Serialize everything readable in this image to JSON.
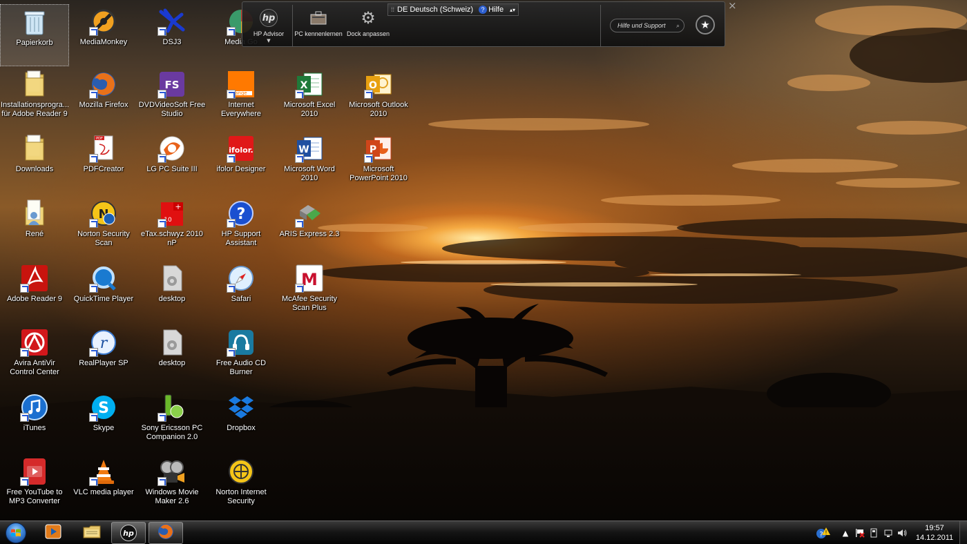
{
  "desktop": {
    "icons": [
      {
        "label": "Papierkorb",
        "icon": "recycle-bin-icon",
        "shortcut": false
      },
      {
        "label": "Installationsprogra... für Adobe Reader 9",
        "icon": "folder-icon",
        "shortcut": false
      },
      {
        "label": "Downloads",
        "icon": "folder-icon",
        "shortcut": false
      },
      {
        "label": "René",
        "icon": "user-folder-icon",
        "shortcut": false
      },
      {
        "label": "Adobe Reader 9",
        "icon": "adobe-reader-icon",
        "shortcut": true
      },
      {
        "label": "Avira AntiVir Control Center",
        "icon": "avira-icon",
        "shortcut": true
      },
      {
        "label": "iTunes",
        "icon": "itunes-icon",
        "shortcut": true
      },
      {
        "label": "Free YouTube to MP3 Converter",
        "icon": "youtube-mp3-icon",
        "shortcut": true
      },
      {
        "label": "MediaMonkey",
        "icon": "mediamonkey-icon",
        "shortcut": true
      },
      {
        "label": "Mozilla Firefox",
        "icon": "firefox-icon",
        "shortcut": true
      },
      {
        "label": "PDFCreator",
        "icon": "pdfcreator-icon",
        "shortcut": true
      },
      {
        "label": "Norton Security Scan",
        "icon": "norton-scan-icon",
        "shortcut": true
      },
      {
        "label": "QuickTime Player",
        "icon": "quicktime-icon",
        "shortcut": true
      },
      {
        "label": "RealPlayer SP",
        "icon": "realplayer-icon",
        "shortcut": true
      },
      {
        "label": "Skype",
        "icon": "skype-icon",
        "shortcut": true
      },
      {
        "label": "VLC media player",
        "icon": "vlc-icon",
        "shortcut": true
      },
      {
        "label": "DSJ3",
        "icon": "dsj3-icon",
        "shortcut": true
      },
      {
        "label": "DVDVideoSoft Free Studio",
        "icon": "dvdvideosoft-icon",
        "shortcut": true
      },
      {
        "label": "LG PC Suite III",
        "icon": "lg-pc-suite-icon",
        "shortcut": true
      },
      {
        "label": "eTax.schwyz 2010 nP",
        "icon": "etax-icon",
        "shortcut": true
      },
      {
        "label": "desktop",
        "icon": "settings-file-icon",
        "shortcut": false
      },
      {
        "label": "desktop",
        "icon": "settings-file-icon",
        "shortcut": false
      },
      {
        "label": "Sony Ericsson PC Companion 2.0",
        "icon": "sony-ericsson-icon",
        "shortcut": true
      },
      {
        "label": "Windows Movie Maker 2.6",
        "icon": "movie-maker-icon",
        "shortcut": true
      },
      {
        "label": "Media Go",
        "icon": "media-go-icon",
        "shortcut": true
      },
      {
        "label": "Internet Everywhere",
        "icon": "orange-icon",
        "shortcut": true
      },
      {
        "label": "ifolor Designer",
        "icon": "ifolor-icon",
        "shortcut": true
      },
      {
        "label": "HP Support Assistant",
        "icon": "hp-support-icon",
        "shortcut": true
      },
      {
        "label": "Safari",
        "icon": "safari-icon",
        "shortcut": true
      },
      {
        "label": "Free Audio CD Burner",
        "icon": "cd-burner-icon",
        "shortcut": true
      },
      {
        "label": "Dropbox",
        "icon": "dropbox-icon",
        "shortcut": false
      },
      {
        "label": "Norton Internet Security",
        "icon": "norton-internet-security-icon",
        "shortcut": false
      },
      {
        "label": "Microsoft Excel 2010",
        "icon": "excel-icon",
        "shortcut": true
      },
      {
        "label": "Microsoft Word 2010",
        "icon": "word-icon",
        "shortcut": true
      },
      {
        "label": "ARIS Express 2.3",
        "icon": "aris-icon",
        "shortcut": true
      },
      {
        "label": "McAfee Security Scan Plus",
        "icon": "mcafee-icon",
        "shortcut": true
      },
      {
        "label": "Microsoft Outlook 2010",
        "icon": "outlook-icon",
        "shortcut": true
      },
      {
        "label": "Microsoft PowerPoint 2010",
        "icon": "powerpoint-icon",
        "shortcut": true
      }
    ]
  },
  "dock": {
    "language": "DE Deutsch (Schweiz)",
    "help": "Hilfe",
    "items": [
      {
        "label": "HP Advisor",
        "icon": "hp-logo-icon"
      },
      {
        "label": "PC kennenlernen",
        "icon": "briefcase-icon"
      },
      {
        "label": "Dock anpassen",
        "icon": "gear-icon"
      }
    ],
    "search_placeholder": "Hilfe und Support",
    "favorite_icon": "star-icon",
    "close_icon": "close-icon"
  },
  "taskbar": {
    "start_icon": "windows-logo-icon",
    "pinned": [
      {
        "name": "media-player",
        "icon": "media-player-icon"
      },
      {
        "name": "explorer",
        "icon": "folder-icon"
      },
      {
        "name": "hp",
        "icon": "hp-logo-icon"
      },
      {
        "name": "firefox",
        "icon": "firefox-icon"
      }
    ],
    "clock": {
      "time": "19:57",
      "date": "14.12.2011"
    },
    "tray": [
      "action-center-icon",
      "show-hidden-icon",
      "flag-icon",
      "usb-icon",
      "network-icon",
      "volume-icon"
    ]
  },
  "colors": {
    "taskbar": "#141414",
    "dock_bg": "#1e1e1e",
    "sun": "#ffecaa",
    "sky_orange": "#d27828"
  }
}
